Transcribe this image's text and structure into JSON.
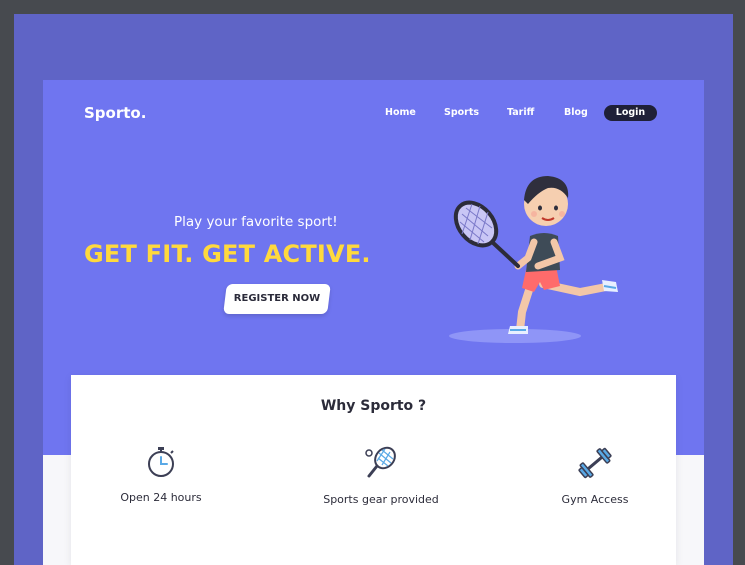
{
  "brand": {
    "name": "Sporto."
  },
  "nav": {
    "items": [
      "Home",
      "Sports",
      "Tariff",
      "Blog"
    ],
    "login_label": "Login"
  },
  "hero": {
    "tagline": "Play your favorite sport!",
    "headline": "GET FIT. GET ACTIVE.",
    "cta_label": "REGISTER NOW"
  },
  "why": {
    "title": "Why Sporto ?",
    "features": [
      {
        "label": "Open 24 hours",
        "icon": "stopwatch-icon"
      },
      {
        "label": "Sports gear provided",
        "icon": "tennis-racket-icon"
      },
      {
        "label": "Gym Access",
        "icon": "dumbbell-icon"
      }
    ]
  },
  "colors": {
    "hero_bg": "#6f75f0",
    "backdrop": "#5f64c6",
    "accent_yellow": "#ffd93d",
    "login_bg": "#1f2038",
    "icon_blue": "#5aa9e6"
  }
}
